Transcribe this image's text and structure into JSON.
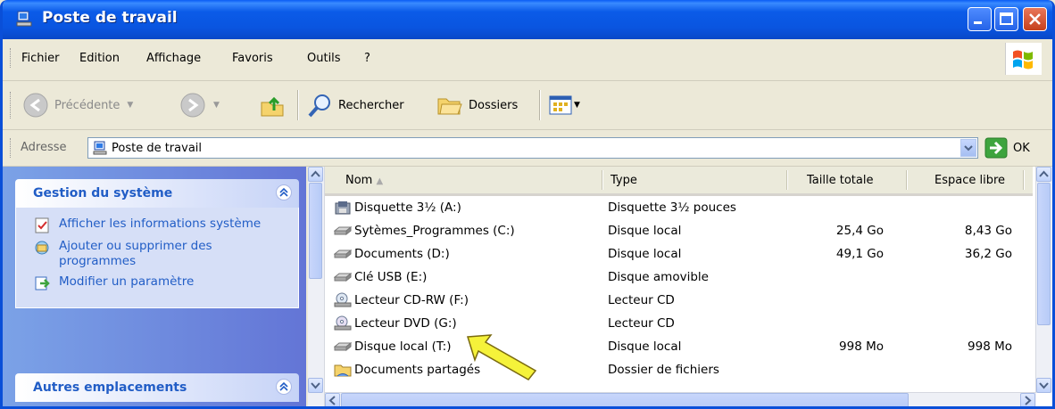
{
  "window": {
    "title": "Poste de travail"
  },
  "menu": {
    "items": [
      "Fichier",
      "Edition",
      "Affichage",
      "Favoris",
      "Outils",
      "?"
    ]
  },
  "toolbar": {
    "back_label": "Précédente",
    "search_label": "Rechercher",
    "folders_label": "Dossiers"
  },
  "address": {
    "label": "Adresse",
    "value": "Poste de travail",
    "go_label": "OK"
  },
  "taskpane": {
    "system": {
      "title": "Gestion du système",
      "tasks": [
        "Afficher les informations système",
        "Ajouter ou supprimer des programmes",
        "Modifier un paramètre"
      ]
    },
    "other": {
      "title": "Autres emplacements"
    }
  },
  "list": {
    "columns": [
      "Nom",
      "Type",
      "Taille totale",
      "Espace libre"
    ],
    "rows": [
      {
        "name": "Disquette 3½ (A:)",
        "type": "Disquette 3½ pouces",
        "total": "",
        "free": "",
        "icon": "floppy-drive-icon"
      },
      {
        "name": "Sytèmes_Programmes (C:)",
        "type": "Disque local",
        "total": "25,4 Go",
        "free": "8,43 Go",
        "icon": "hard-drive-icon"
      },
      {
        "name": "Documents (D:)",
        "type": "Disque local",
        "total": "49,1 Go",
        "free": "36,2 Go",
        "icon": "hard-drive-icon"
      },
      {
        "name": "Clé USB (E:)",
        "type": "Disque amovible",
        "total": "",
        "free": "",
        "icon": "removable-drive-icon"
      },
      {
        "name": "Lecteur CD-RW (F:)",
        "type": "Lecteur CD",
        "total": "",
        "free": "",
        "icon": "cd-drive-icon"
      },
      {
        "name": "Lecteur DVD (G:)",
        "type": "Lecteur CD",
        "total": "",
        "free": "",
        "icon": "dvd-drive-icon"
      },
      {
        "name": "Disque local (T:)",
        "type": "Disque local",
        "total": "998 Mo",
        "free": "998 Mo",
        "icon": "hard-drive-icon"
      },
      {
        "name": "Documents partagés",
        "type": "Dossier de fichiers",
        "total": "",
        "free": "",
        "icon": "shared-folder-icon"
      }
    ]
  },
  "colors": {
    "title_bar": "#0a55e0",
    "task_link": "#215dc6",
    "pointer_arrow": "#f5f23a"
  }
}
